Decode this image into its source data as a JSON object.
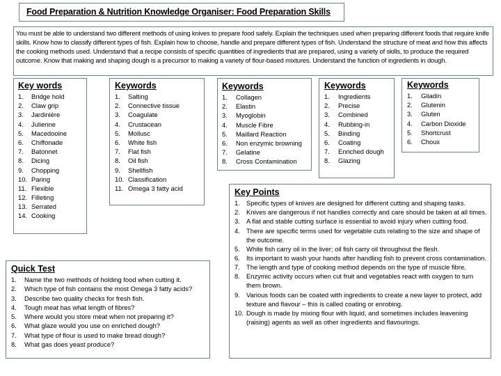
{
  "header": {
    "title": "Food Preparation & Nutrition Knowledge Organiser: Food Preparation Skills"
  },
  "intro": {
    "text": "You must be able to understand two different methods of using knives to prepare food safely.  Explain the techniques used when preparing different foods that require knife skills.  Know how to classify different types of fish.  Explain how to choose, handle and prepare different types of fish.  Understand the structure of meat and how this affects the cooking methods used.  Understand that a recipe consists of specific quantities of ingredients that are prepared, using a variety of skills, to produce the required outcome.  Know that making and shaping dough is a precursor to making a variety of flour-based mixtures.  Understand the function of ingredients in dough."
  },
  "keyword_boxes": [
    {
      "heading": "Key words",
      "items": [
        {
          "num": "1.",
          "text": "Bridge hold"
        },
        {
          "num": "2.",
          "text": "Claw grip"
        },
        {
          "num": "3.",
          "text": "Jardinière"
        },
        {
          "num": "4.",
          "text": "Julienne"
        },
        {
          "num": "5.",
          "text": "Macedooine"
        },
        {
          "num": "6.",
          "text": "Chiffonade"
        },
        {
          "num": "7.",
          "text": "Batonnet"
        },
        {
          "num": "8.",
          "text": "Dicing"
        },
        {
          "num": "9.",
          "text": "Chopping"
        },
        {
          "num": "10.",
          "text": "Paring"
        },
        {
          "num": "11.",
          "text": "Flexible"
        },
        {
          "num": "12.",
          "text": "Filleting"
        },
        {
          "num": "13.",
          "text": "Serrated"
        },
        {
          "num": "14.",
          "text": "Cooking"
        }
      ]
    },
    {
      "heading": "Keywords",
      "items": [
        {
          "num": "1.",
          "text": "Salting"
        },
        {
          "num": "2.",
          "text": "Connective tissue"
        },
        {
          "num": "3.",
          "text": "Coagulate"
        },
        {
          "num": "4.",
          "text": "Crustacean"
        },
        {
          "num": "5.",
          "text": "Mollusc"
        },
        {
          "num": "6.",
          "text": "White fish"
        },
        {
          "num": "7.",
          "text": "Flat fish"
        },
        {
          "num": "8.",
          "text": "Oil fish"
        },
        {
          "num": "9.",
          "text": "Shellfish"
        },
        {
          "num": "10.",
          "text": "Classification"
        },
        {
          "num": "11.",
          "text": "Omega 3 fatty acid"
        }
      ]
    },
    {
      "heading": "Keywords",
      "items": [
        {
          "num": "1.",
          "text": "Collagen"
        },
        {
          "num": "2.",
          "text": "Elastin"
        },
        {
          "num": "3.",
          "text": "Myoglobin"
        },
        {
          "num": "4.",
          "text": "Muscle Fibre"
        },
        {
          "num": "5.",
          "text": "Maillard Reaction"
        },
        {
          "num": "6.",
          "text": "Non enzymic browning"
        },
        {
          "num": "7.",
          "text": "Gelatine"
        },
        {
          "num": "8.",
          "text": "Cross Contamination"
        }
      ]
    },
    {
      "heading": "Keywords",
      "items": [
        {
          "num": "1.",
          "text": "Ingredients"
        },
        {
          "num": "2.",
          "text": "Precise"
        },
        {
          "num": "3.",
          "text": "Combined"
        },
        {
          "num": "4.",
          "text": "Rubbing-in"
        },
        {
          "num": "5.",
          "text": "Binding"
        },
        {
          "num": "6.",
          "text": "Coating"
        },
        {
          "num": "7.",
          "text": "Enriched dough"
        },
        {
          "num": "8.",
          "text": "Glazing"
        }
      ]
    },
    {
      "heading": "Keywords",
      "items": [
        {
          "num": "1.",
          "text": "Gliadin"
        },
        {
          "num": "2.",
          "text": "Glutenin"
        },
        {
          "num": "3.",
          "text": "Gluten"
        },
        {
          "num": "4.",
          "text": "Carbon Dioxide"
        },
        {
          "num": "5.",
          "text": "Shortcrust"
        },
        {
          "num": "6.",
          "text": "Choux"
        }
      ]
    }
  ],
  "quick_test": {
    "heading": "Quick Test",
    "items": [
      {
        "num": "1.",
        "text": "Name the two methods of holding food when cutting it."
      },
      {
        "num": "2.",
        "text": "Which type of fish contains the most Omega 3 fatty acids?"
      },
      {
        "num": "3.",
        "text": "Describe two quality checks for fresh fish."
      },
      {
        "num": "4.",
        "text": "Tough meat has what length of fibres?"
      },
      {
        "num": "5.",
        "text": "Where would you store meat when not preparing it?"
      },
      {
        "num": "6.",
        "text": "What glaze would you use on enriched dough?"
      },
      {
        "num": "7.",
        "text": "What type of flour is used to make bread dough?"
      },
      {
        "num": "8.",
        "text": "What gas does yeast produce?"
      }
    ]
  },
  "key_points": {
    "heading": "Key Points",
    "items": [
      {
        "num": "1.",
        "text": "Specific types of knives are designed for different cutting and shaping tasks."
      },
      {
        "num": "2.",
        "text": "Knives are dangerous if not handles correctly and care should be taken at all times."
      },
      {
        "num": "3.",
        "text": "A flat and stable cutting surface is essential to avoid injury when cutting food."
      },
      {
        "num": "4.",
        "text": "There are specific terms used for vegetable cuts relating to the size and shape of the outcome."
      },
      {
        "num": "5.",
        "text": "White fish carry oil in the liver; oil fish carry oil throughout the flesh."
      },
      {
        "num": "6.",
        "text": "Its important to wash your hands after handling fish to prevent cross contamination."
      },
      {
        "num": "7.",
        "text": "The length and type of cooking method depends on the type of muscle fibre."
      },
      {
        "num": "8.",
        "text": "Enzymic activity occurs when cut fruit and vegetables react with oxygen to turn them brown."
      },
      {
        "num": "9.",
        "text": "Various foods can be coated with ingredients to create a new layer to protect, add texture and flavour – this is called coating or enrobing."
      },
      {
        "num": "10.",
        "text": "Dough is made by mixing flour with liquid, and sometimes includes leavening (raising) agents as well as other ingredients and flavourings."
      }
    ]
  }
}
